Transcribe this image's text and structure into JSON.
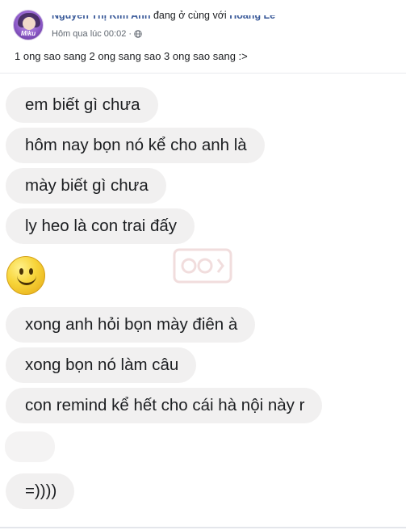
{
  "post": {
    "author": "Nguyễn Thị Kim Anh",
    "with_text": "đang ở cùng với",
    "friend": "Hoàng Lê",
    "time": "Hôm qua lúc 00:02",
    "separator": "·",
    "privacy_icon": "globe-icon",
    "avatar_text": "Miku",
    "caption": "1 ong sao sang 2 ong sang sao 3 ong sao sang :>"
  },
  "chat": {
    "messages": [
      "em biết gì chưa",
      "hôm nay bọn nó kể cho anh là",
      "mày biết gì chưa",
      "ly heo là con trai đấy",
      "xong anh hỏi bọn mày điên à",
      "xong bọn nó làm câu",
      "con remind kể hết cho cái hà nội này r",
      "=))))"
    ],
    "emoji": "smiley-emoji-icon",
    "watermark_icon": "watermark-icon"
  }
}
